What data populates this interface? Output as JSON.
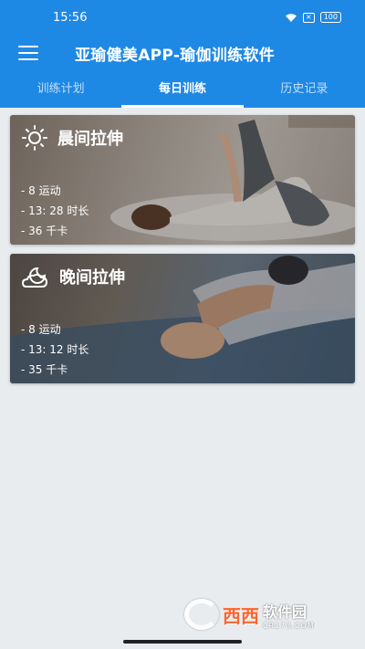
{
  "status": {
    "time": "15:56",
    "battery": "100"
  },
  "appbar": {
    "title": "亚瑜健美APP-瑜伽训练软件"
  },
  "tabs": [
    {
      "label": "训练计划"
    },
    {
      "label": "每日训练"
    },
    {
      "label": "历史记录"
    }
  ],
  "cards": [
    {
      "title": "晨间拉伸",
      "icon": "sun-icon",
      "exercises": "- 8 运动",
      "duration": "- 13: 28 时长",
      "calories": "- 36 千卡"
    },
    {
      "title": "晚间拉伸",
      "icon": "moon-cloud-icon",
      "exercises": "- 8 运动",
      "duration": "- 13: 12 时长",
      "calories": "- 35 千卡"
    }
  ],
  "watermark": {
    "text": "西西",
    "cn": "软件园",
    "url": "CR173.COM"
  }
}
